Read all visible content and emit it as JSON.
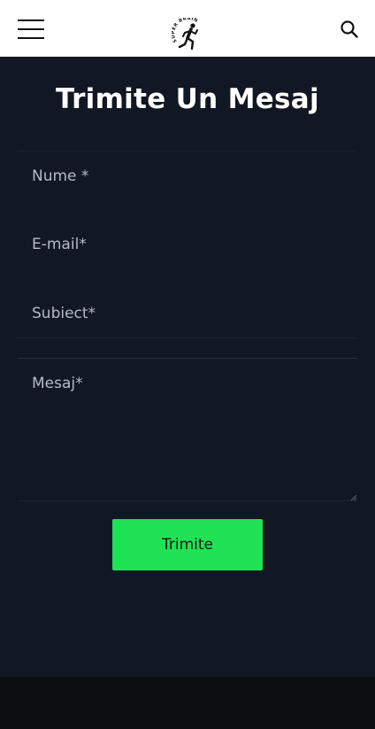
{
  "header": {
    "logo_text": "SUPER BRAIN",
    "menu_icon": "hamburger-menu-icon",
    "search_icon": "search-icon"
  },
  "form": {
    "title": "Trimite Un Mesaj",
    "name_placeholder": "Nume *",
    "email_placeholder": "E-mail*",
    "subject_placeholder": "Subiect*",
    "message_placeholder": "Mesaj*",
    "submit_label": "Trimite"
  },
  "colors": {
    "accent": "#1fe255",
    "background": "#111823",
    "header_bg": "#ffffff",
    "footer_bg": "#0c0e12"
  }
}
